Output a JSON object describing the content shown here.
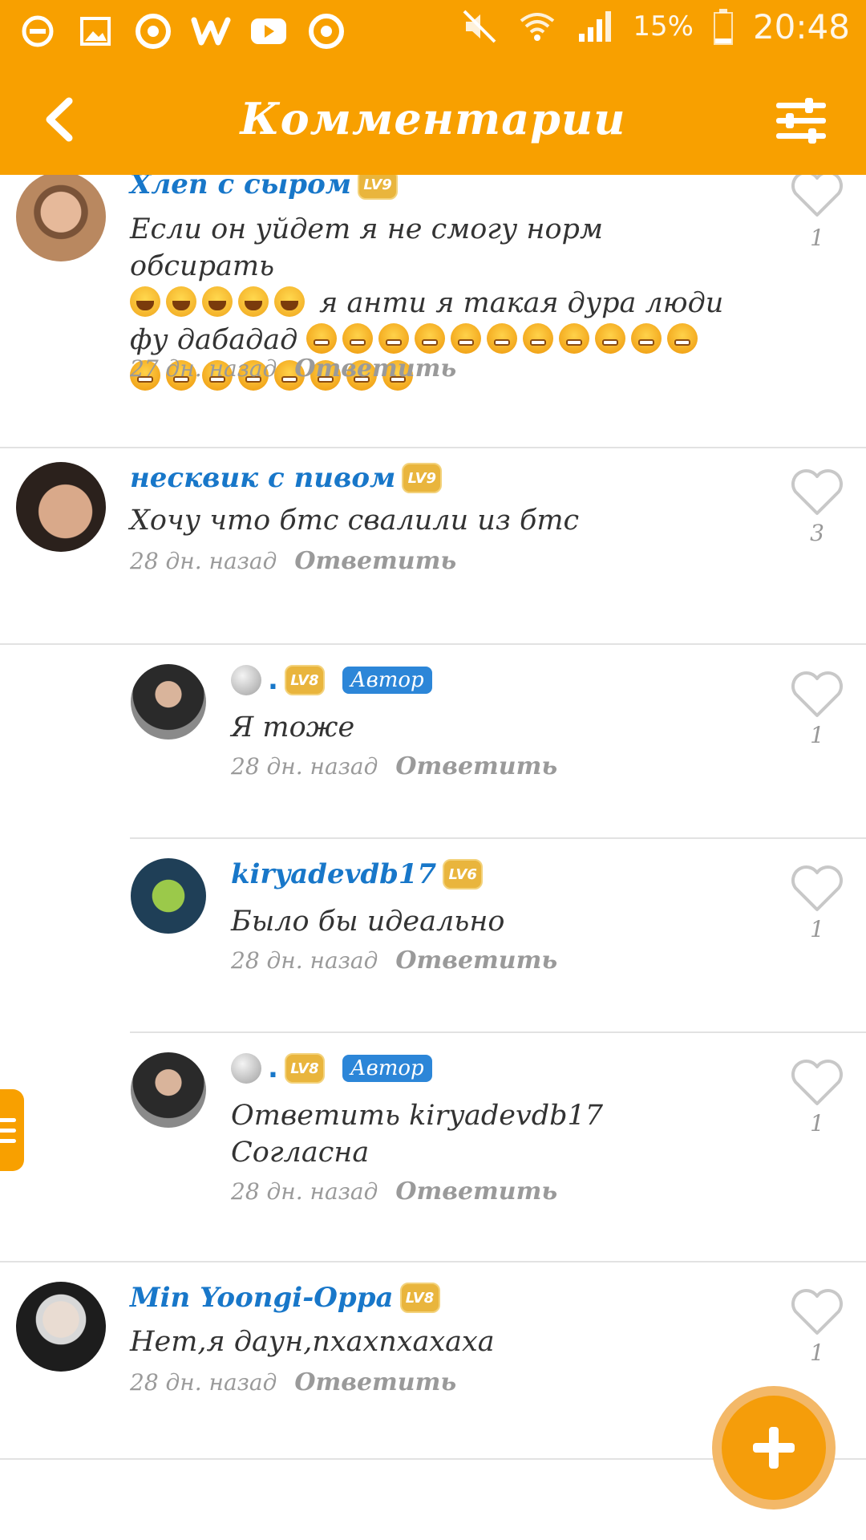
{
  "status_bar": {
    "battery": "15%",
    "time": "20:48",
    "icons": [
      "blocked-icon",
      "gallery-icon",
      "chrome-icon",
      "w-app-icon",
      "youtube-icon",
      "chrome-icon",
      "mute-icon",
      "wifi-icon",
      "signal-icon",
      "battery-icon"
    ]
  },
  "app_bar": {
    "title": "Комментарии",
    "back_icon": "chevron-left-icon",
    "filter_icon": "sliders-icon"
  },
  "colors": {
    "accent": "#f8a000",
    "username": "#1877c9",
    "author_badge": "#2c86d8",
    "muted": "#9a9a9a"
  },
  "comments": [
    {
      "username": "Хлеп с сыром",
      "level": "LV9",
      "text_lines": [
        "Если он уйдет я не смогу норм обсирать",
        "я анти я такая дура люди",
        "фу дабадад"
      ],
      "time": "27 дн. назад",
      "reply": "Ответить",
      "likes": "1"
    },
    {
      "username": "несквик с пивом",
      "level": "LV9",
      "text": "Хочу что бтс свалили из бтс",
      "time": "28 дн. назад",
      "reply": "Ответить",
      "likes": "3"
    },
    {
      "username": ".",
      "level": "LV8",
      "badge": "Автор",
      "text": "Я тоже",
      "time": "28 дн. назад",
      "reply": "Ответить",
      "likes": "1"
    },
    {
      "username": "kiryadevdb17",
      "level": "LV6",
      "text": "Было бы идеально",
      "time": "28 дн. назад",
      "reply": "Ответить",
      "likes": "1"
    },
    {
      "username": ".",
      "level": "LV8",
      "badge": "Автор",
      "text_lines": [
        "Ответить kiryadevdb17",
        "Согласна"
      ],
      "time": "28 дн. назад",
      "reply": "Ответить",
      "likes": "1"
    },
    {
      "username": "Min Yoongi-Oppa",
      "level": "LV8",
      "text": "Нет,я даун,пхахпхахаха",
      "time": "28 дн. назад",
      "reply": "Ответить",
      "likes": "1"
    }
  ],
  "fab": {
    "icon": "plus-icon"
  },
  "side_tab": {
    "icon": "menu-icon"
  }
}
